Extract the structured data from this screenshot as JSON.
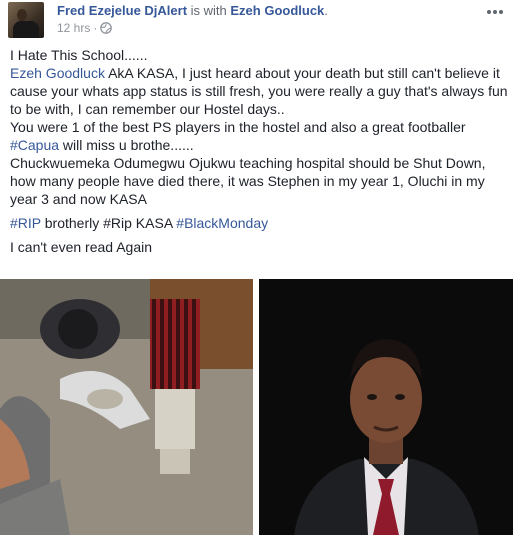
{
  "post": {
    "author": "Fred Ezejelue DjAlert",
    "with_text": " is with ",
    "tagged": "Ezeh Goodluck",
    "tagged_end": ".",
    "time": "12 hrs",
    "time_sep": "·",
    "more_icon": "more-dots-icon"
  },
  "content": {
    "line1": "I Hate This School......",
    "p2_link": "Ezeh Goodluck",
    "p2_text": " AkA KASA, I just heard about your death but still can't believe it cause your whats app status is still fresh, you were really a guy that's always fun to be with, I can remember our Hostel days..",
    "p3_text": "You were 1 of the best PS players in the hostel and also a great footballer",
    "p3_tag": "#Capua",
    "p3_rest": " will miss u brothe......",
    "p4_text": "Chuckwuemeka Odumegwu Ojukwu teaching hospital should be Shut Down, how many people have died there, it was Stephen in my year 1, Oluchi in my year 3 and now KASA",
    "tag_rip": "#RIP",
    "tag_mid": " brotherly #Rip KASA ",
    "tag_bm": "#BlackMonday",
    "last_line": "I can't even read Again"
  },
  "colors": {
    "link": "#365899",
    "text": "#1d2129",
    "meta": "#90949c"
  }
}
